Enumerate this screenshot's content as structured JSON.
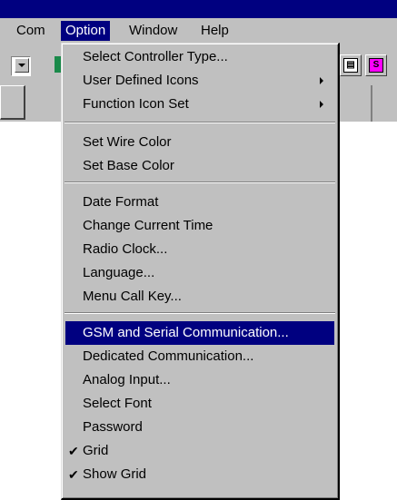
{
  "menubar": {
    "com": "Com",
    "option": "Option",
    "window": "Window",
    "help": "Help"
  },
  "toolbar": {
    "icon_left": "green-tool-icon",
    "icon_right_1_label": "▤",
    "icon_right_2_label": "S"
  },
  "option_menu": {
    "items": [
      {
        "label": "Select Controller Type...",
        "submenu": false,
        "checked": false
      },
      {
        "label": "User Defined Icons",
        "submenu": true,
        "checked": false
      },
      {
        "label": "Function Icon Set",
        "submenu": true,
        "checked": false
      },
      {
        "label": "Set Wire Color",
        "submenu": false,
        "checked": false
      },
      {
        "label": "Set Base Color",
        "submenu": false,
        "checked": false
      },
      {
        "label": "Date Format",
        "submenu": false,
        "checked": false
      },
      {
        "label": "Change Current Time",
        "submenu": false,
        "checked": false
      },
      {
        "label": "Radio Clock...",
        "submenu": false,
        "checked": false
      },
      {
        "label": "Language...",
        "submenu": false,
        "checked": false
      },
      {
        "label": "Menu Call Key...",
        "submenu": false,
        "checked": false
      },
      {
        "label": "GSM and Serial Communication...",
        "submenu": false,
        "checked": false,
        "highlighted": true
      },
      {
        "label": "Dedicated Communication...",
        "submenu": false,
        "checked": false
      },
      {
        "label": "Analog Input...",
        "submenu": false,
        "checked": false
      },
      {
        "label": "Select Font",
        "submenu": false,
        "checked": false
      },
      {
        "label": "Password",
        "submenu": false,
        "checked": false
      },
      {
        "label": "Grid",
        "submenu": false,
        "checked": true
      },
      {
        "label": "Show Grid",
        "submenu": false,
        "checked": true
      }
    ],
    "check_glyph": "✔"
  }
}
